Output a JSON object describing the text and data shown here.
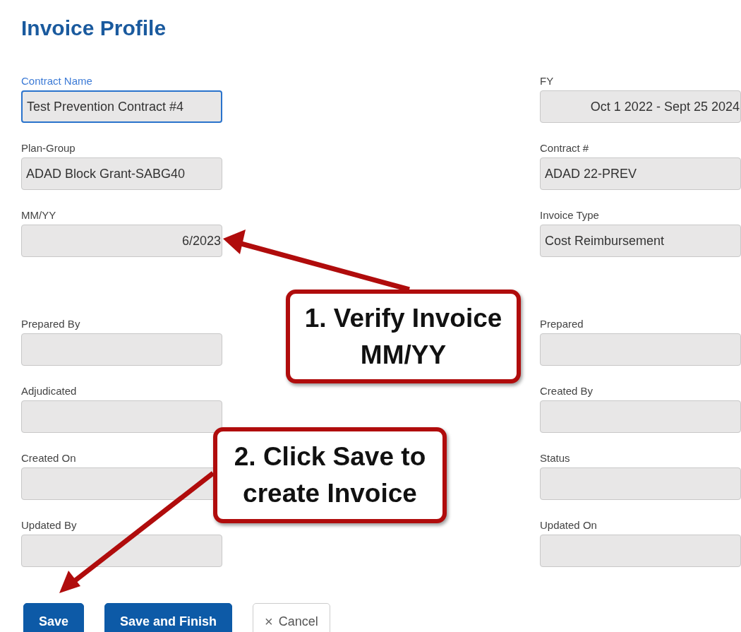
{
  "title": "Invoice Profile",
  "groups": [
    {
      "rows": [
        {
          "left": {
            "label": "Contract Name",
            "value": "Test Prevention Contract #4",
            "right_aligned": false,
            "focused": true
          },
          "right": {
            "label": "FY",
            "value": "Oct 1 2022 - Sept 25 2024",
            "right_aligned": true,
            "focused": false
          }
        },
        {
          "left": {
            "label": "Plan-Group",
            "value": "ADAD Block Grant-SABG40",
            "right_aligned": false,
            "focused": false
          },
          "right": {
            "label": "Contract #",
            "value": "ADAD 22-PREV",
            "right_aligned": false,
            "focused": false
          }
        },
        {
          "left": {
            "label": "MM/YY",
            "value": "6/2023",
            "right_aligned": true,
            "focused": false
          },
          "right": {
            "label": "Invoice Type",
            "value": "Cost Reimbursement",
            "right_aligned": false,
            "focused": false
          }
        }
      ]
    },
    {
      "rows": [
        {
          "left": {
            "label": "Prepared By",
            "focused": false
          },
          "right": {
            "label": "Prepared",
            "focused": false
          }
        },
        {
          "left": {
            "label": "Adjudicated",
            "focused": false
          },
          "right": {
            "label": "Created By",
            "focused": false
          }
        },
        {
          "left": {
            "label": "Created On",
            "focused": false
          },
          "right": {
            "label": "Status",
            "focused": false
          }
        },
        {
          "left": {
            "label": "Updated By",
            "focused": false
          },
          "right": {
            "label": "Updated On",
            "focused": false
          }
        }
      ]
    }
  ],
  "buttons": [
    {
      "kind": "primary",
      "label": "Save"
    },
    {
      "kind": "primary",
      "label": "Save and Finish"
    },
    {
      "kind": "outline",
      "label": "Cancel",
      "icon": "×"
    }
  ],
  "callouts": [
    {
      "text": "1. Verify Invoice MM/YY"
    },
    {
      "text": "2. Click Save to create Invoice"
    }
  ]
}
